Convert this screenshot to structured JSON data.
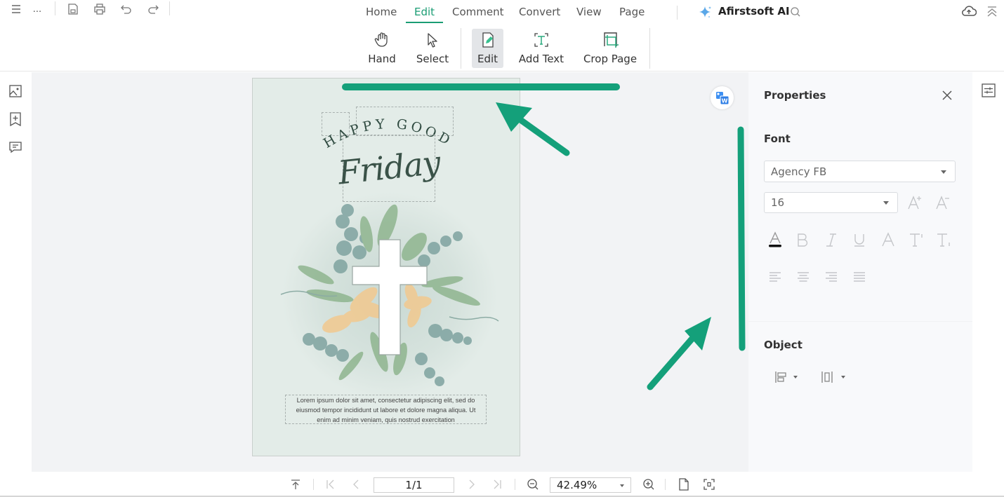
{
  "topbar": {
    "nav_tabs": [
      {
        "label": "Home",
        "active": false
      },
      {
        "label": "Edit",
        "active": true
      },
      {
        "label": "Comment",
        "active": false
      },
      {
        "label": "Convert",
        "active": false
      },
      {
        "label": "View",
        "active": false
      },
      {
        "label": "Page",
        "active": false
      }
    ],
    "ai_label": "Afirstsoft AI",
    "more_label": "..."
  },
  "ribbon": {
    "buttons": [
      {
        "label": "Hand",
        "icon": "hand-icon",
        "active": false
      },
      {
        "label": "Select",
        "icon": "cursor-icon",
        "active": false
      },
      {
        "label": "Edit",
        "icon": "edit-document-icon",
        "active": true
      },
      {
        "label": "Add Text",
        "icon": "add-text-icon",
        "active": false
      },
      {
        "label": "Crop Page",
        "icon": "crop-icon",
        "active": false
      }
    ]
  },
  "document": {
    "heading_arc": "HAPPY GOOD",
    "heading_script": "Friday",
    "body_lines": [
      "Lorem ipsum dolor sit amet, consectetur adipiscing elit, sed do",
      "eiusmod tempor incididunt ut labore et dolore magna aliqua. Ut",
      "enim ad minim veniam, quis nostrud exercitation"
    ]
  },
  "properties": {
    "title": "Properties",
    "font_section": "Font",
    "font_family": "Agency FB",
    "font_size": "16",
    "format_buttons": [
      "font-color",
      "bold",
      "italic",
      "underline",
      "strikethrough",
      "superscript",
      "subscript"
    ],
    "align_buttons": [
      "align-left",
      "align-center",
      "align-right",
      "align-justify"
    ],
    "object_section": "Object"
  },
  "bottombar": {
    "page_indicator": "1/1",
    "zoom": "42.49%"
  },
  "colors": {
    "accent": "#1b9d74",
    "annotation": "#14a07a",
    "page_bg": "#e3ece8"
  }
}
